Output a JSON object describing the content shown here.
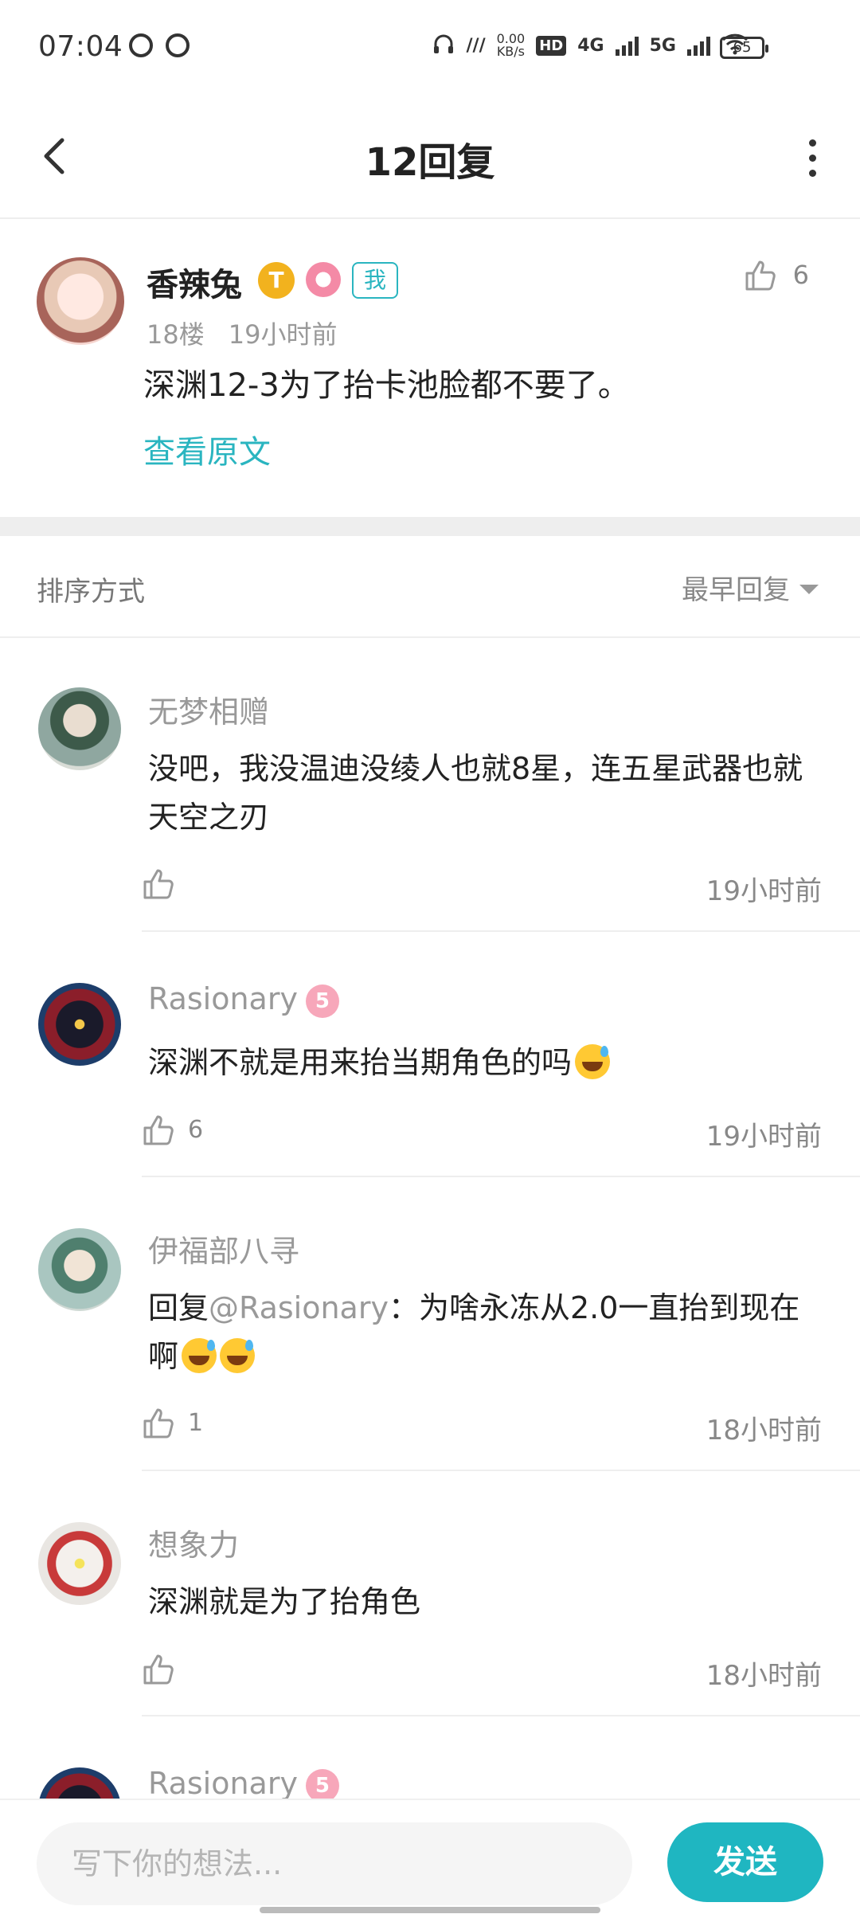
{
  "status_bar": {
    "time": "07:04",
    "net_speed": "0.00",
    "net_unit": "KB/s",
    "hd": "HD",
    "net1": "4G",
    "net2": "5G",
    "battery": "65"
  },
  "header": {
    "title": "12回复"
  },
  "original": {
    "author": "香辣兔",
    "badge_gold": "T",
    "badge_me": "我",
    "likes": "6",
    "floor": "18楼",
    "time": "19小时前",
    "text": "深渊12-3为了抬卡池脸都不要了。",
    "view_original": "查看原文"
  },
  "sort": {
    "label": "排序方式",
    "selected": "最早回复"
  },
  "replies": [
    {
      "name": "无梦相赠",
      "text": "没吧，我没温迪没绫人也就8星，连五星武器也就天空之刃",
      "likes": "",
      "time": "19小时前"
    },
    {
      "name": "Rasionary",
      "badge": "5",
      "text": "深渊不就是用来抬当期角色的吗",
      "likes": "6",
      "time": "19小时前"
    },
    {
      "name": "伊福部八寻",
      "reply_prefix": "回复",
      "mention": "@Rasionary",
      "text": "：为啥永冻从2.0一直抬到现在啊",
      "likes": "1",
      "time": "18小时前"
    },
    {
      "name": "想象力",
      "text": "深渊就是为了抬角色",
      "likes": "",
      "time": "18小时前"
    },
    {
      "name": "Rasionary",
      "badge": "5"
    }
  ],
  "input": {
    "placeholder": "写下你的想法..."
  },
  "send": {
    "label": "发送"
  },
  "colors": {
    "accent": "#1fb6c1",
    "muted_text": "#999999",
    "divider": "#eeeeee"
  }
}
